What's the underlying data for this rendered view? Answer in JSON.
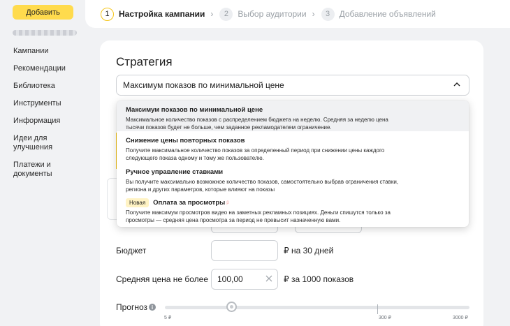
{
  "sidebar": {
    "add_button": "Добавить",
    "items": [
      {
        "label": "Кампании"
      },
      {
        "label": "Рекомендации"
      },
      {
        "label": "Библиотека"
      },
      {
        "label": "Инструменты"
      },
      {
        "label": "Информация"
      },
      {
        "label": "Идеи для улучшения"
      },
      {
        "label": "Платежи и документы"
      }
    ]
  },
  "stepper": {
    "steps": [
      {
        "num": "1",
        "label": "Настройка кампании",
        "state": "active"
      },
      {
        "num": "2",
        "label": "Выбор аудитории",
        "state": "inactive"
      },
      {
        "num": "3",
        "label": "Добавление объявлений",
        "state": "inactive"
      }
    ]
  },
  "strategy": {
    "title": "Стратегия",
    "selected": "Максимум показов по минимальной цене",
    "options": [
      {
        "title": "Максимум показов по минимальной цене",
        "desc": "Максимальное количество показов с распределением бюджета на неделю. Средняя за неделю цена тысячи показов будет не больше, чем заданное рекламодателем ограничение."
      },
      {
        "title": "Снижение цены повторных показов",
        "desc": "Получите максимальное количество показов за определенный период при снижении цены каждого следующего показа одному и тому же пользователю."
      },
      {
        "title": "Ручное управление ставками",
        "desc": "Вы получите максимально возможное количество показов, самостоятельно выбрав ограничения ставки, региона и других параметров, которые влияют на показы"
      },
      {
        "badge": "Новая",
        "title": "Оплата за просмотры",
        "beta": "β",
        "desc": "Получите максимум просмотров видео на заметных рекламных позициях. Деньги спишутся только за просмотры — средняя цена просмотра за период не превысит назначенную вами."
      }
    ]
  },
  "budget": {
    "label": "Бюджет",
    "value": "",
    "suffix": "₽ на 30 дней"
  },
  "avg_price": {
    "label": "Средняя цена не более",
    "value": "100,00",
    "suffix": "₽ за 1000 показов"
  },
  "forecast": {
    "label": "Прогноз",
    "info_icon": "i",
    "slider_position_fraction": 0.22,
    "ticks": [
      {
        "label": "5 ₽"
      },
      {
        "label": "300 ₽"
      },
      {
        "label": "3000 ₽"
      }
    ]
  },
  "colors": {
    "accent": "#ffdb4d",
    "step_active_ring": "#f5c518"
  }
}
